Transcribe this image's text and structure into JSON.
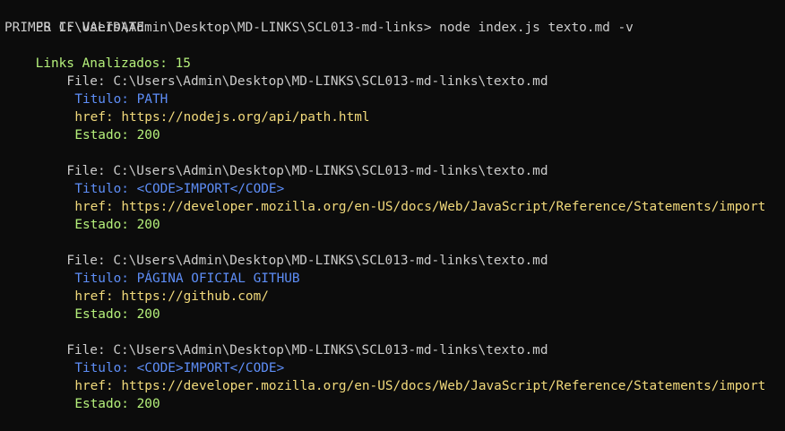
{
  "terminal": {
    "prompt": "PS C:\\Users\\Admin\\Desktop\\MD-LINKS\\SCL013-md-links>",
    "command": " node index.js texto.md -v",
    "header_line": "PRIMER IF VALIDATE",
    "analyzed_label": "Links Analizados:",
    "analyzed_count": "15"
  },
  "entries": [
    {
      "file_label": "File:",
      "file_path": "C:\\Users\\Admin\\Desktop\\MD-LINKS\\SCL013-md-links\\texto.md",
      "title_label": "Titulo:",
      "title_value": "PATH",
      "href_label": "href:",
      "href_value": "https://nodejs.org/api/path.html",
      "status_label": "Estado:",
      "status_value": "200"
    },
    {
      "file_label": "File:",
      "file_path": "C:\\Users\\Admin\\Desktop\\MD-LINKS\\SCL013-md-links\\texto.md",
      "title_label": "Titulo:",
      "title_value": "<CODE>IMPORT</CODE>",
      "href_label": "href:",
      "href_value": "https://developer.mozilla.org/en-US/docs/Web/JavaScript/Reference/Statements/import",
      "status_label": "Estado:",
      "status_value": "200"
    },
    {
      "file_label": "File:",
      "file_path": "C:\\Users\\Admin\\Desktop\\MD-LINKS\\SCL013-md-links\\texto.md",
      "title_label": "Titulo:",
      "title_value": "PÁGINA OFICIAL GITHUB",
      "href_label": "href:",
      "href_value": "https://github.com/",
      "status_label": "Estado:",
      "status_value": "200"
    },
    {
      "file_label": "File:",
      "file_path": "C:\\Users\\Admin\\Desktop\\MD-LINKS\\SCL013-md-links\\texto.md",
      "title_label": "Titulo:",
      "title_value": "<CODE>IMPORT</CODE>",
      "href_label": "href:",
      "href_value": "https://developer.mozilla.org/en-US/docs/Web/JavaScript/Reference/Statements/import",
      "status_label": "Estado:",
      "status_value": "200"
    }
  ],
  "colors": {
    "background": "#0c0c0c",
    "default_text": "#cccccc",
    "green": "#b5f07b",
    "blue": "#5e8ef7",
    "yellow": "#f1d97b"
  }
}
